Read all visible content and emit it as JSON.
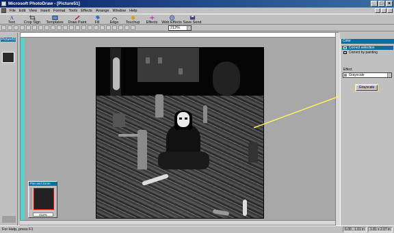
{
  "window": {
    "title": "Microsoft PhotoDraw - [Picture51]"
  },
  "menu": [
    "File",
    "Edit",
    "View",
    "Insert",
    "Format",
    "Tools",
    "Effects",
    "Arrange",
    "Window",
    "Help"
  ],
  "toolbar": {
    "tools": [
      "Text",
      "Crop Sign",
      "Templates",
      "Draw Paint",
      "Fill",
      "Edge",
      "Touchup",
      "Effects",
      "Web Effects",
      "Save Send"
    ],
    "zoom_value": "212%"
  },
  "picture_list": {
    "title": "Picture51"
  },
  "effect_panel": {
    "title": "Color",
    "options": [
      "Correct selection",
      "Correct by painting"
    ],
    "effect_label": "Effect",
    "effect_value": "Grayscale",
    "button_label": "Grayscale"
  },
  "pan_zoom": {
    "title": "Pan and Zoom",
    "zoom": "212%"
  },
  "status": {
    "help_text": "For Help, press F1",
    "position": "6.00 , 1.01 in",
    "size": "1.81 x 2.07 in"
  },
  "colors": {
    "titlebar": "#0a246a",
    "accent": "#0a6fa0",
    "arrow": "#ffef60"
  }
}
